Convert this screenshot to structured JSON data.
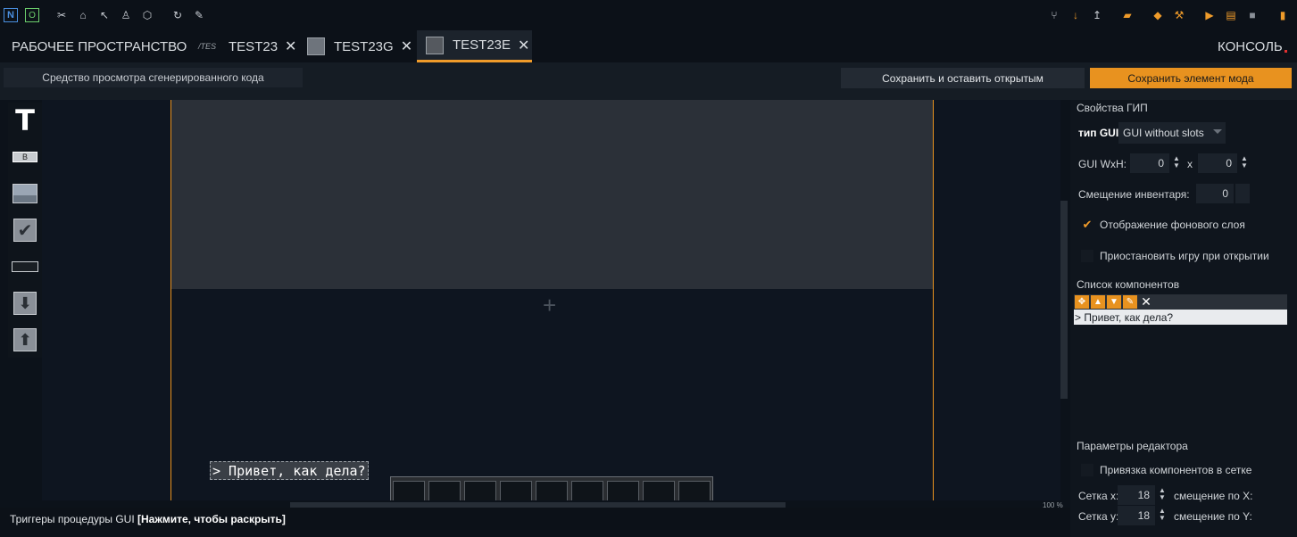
{
  "topbar": {
    "left_icons": [
      "n-icon",
      "o-icon",
      "scissors-icon",
      "shape-icon",
      "cursor-icon",
      "shirt-icon",
      "cube-icon",
      "refresh-icon",
      "wrench-icon"
    ],
    "right_icons": [
      "branch-icon",
      "download-icon",
      "upload-icon",
      "folder-icon",
      "eraser-icon",
      "hammer-icon",
      "play-icon",
      "debug-icon",
      "stop-icon",
      "file-icon"
    ]
  },
  "tabs": {
    "workspace": "РАБОЧЕЕ ПРОСТРАНСТВО",
    "items": [
      {
        "label": "TEST23",
        "icon": "text-icon"
      },
      {
        "label": "TEST23G",
        "icon": "gui-icon"
      },
      {
        "label": "TEST23E",
        "icon": "editor-icon",
        "active": true
      }
    ],
    "console": "КОНСОЛЬ"
  },
  "toolbar": {
    "code_viewer": "Средство просмотра сгенерированного кода",
    "save_keep_open": "Сохранить и оставить открытым",
    "save_mod_element": "Сохранить элемент мода"
  },
  "palette": {
    "items": [
      "text-tool-icon",
      "button-tool-icon",
      "image-tool-icon",
      "checkbox-tool-icon",
      "textfield-tool-icon",
      "input-slot-icon",
      "output-slot-icon"
    ]
  },
  "canvas": {
    "label_text": "> Привет, как дела?",
    "slot_count": 9,
    "zoom": "100 %"
  },
  "gui_properties": {
    "title": "Свойства ГИП",
    "type_label": "тип GUI:",
    "type_value": "GUI without slots",
    "wh_label": "GUI WxH:",
    "width": "0",
    "x_sep": "x",
    "height": "0",
    "inv_offset_label": "Смещение инвентаря:",
    "inv_offset": "0",
    "bg_layer_label": "Отображение фонового слоя",
    "bg_layer_checked": true,
    "pause_label": "Приостановить игру при открытии",
    "pause_checked": false
  },
  "components": {
    "title": "Список компонентов",
    "items": [
      "> Привет, как дела?"
    ]
  },
  "editor_params": {
    "title": "Параметры редактора",
    "snap_label": "Привязка компонентов в сетке",
    "grid_x_label": "Сетка x:",
    "grid_x": "18",
    "offset_x_label": "смещение по X:",
    "grid_y_label": "Сетка y:",
    "grid_y": "18",
    "offset_y_label": "смещение по Y:"
  },
  "statusbar": {
    "text": "Триггеры процедуры GUI",
    "hint": "[Нажмите, чтобы раскрыть]"
  },
  "colors": {
    "accent": "#e8921f",
    "background": "#0c121a"
  }
}
